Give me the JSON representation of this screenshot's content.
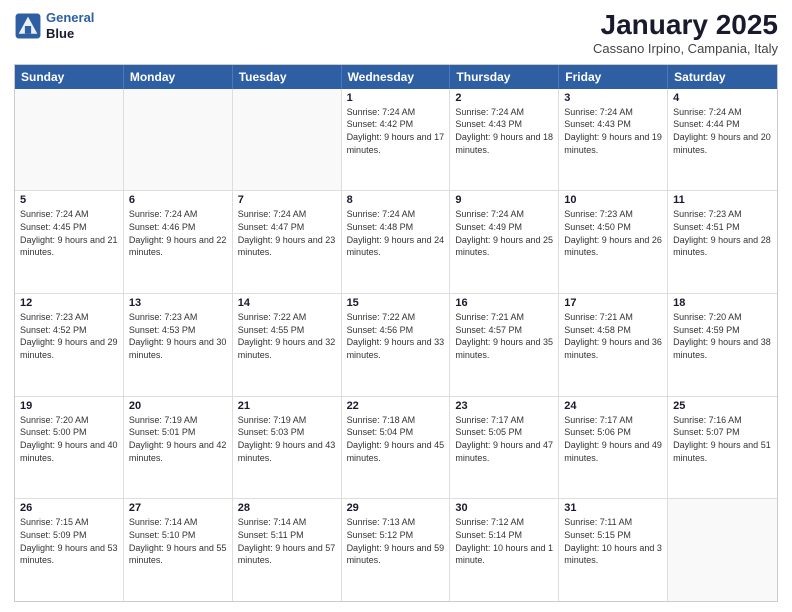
{
  "header": {
    "logo_line1": "General",
    "logo_line2": "Blue",
    "month_title": "January 2025",
    "location": "Cassano Irpino, Campania, Italy"
  },
  "day_headers": [
    "Sunday",
    "Monday",
    "Tuesday",
    "Wednesday",
    "Thursday",
    "Friday",
    "Saturday"
  ],
  "weeks": [
    [
      {
        "day": "",
        "empty": true
      },
      {
        "day": "",
        "empty": true
      },
      {
        "day": "",
        "empty": true
      },
      {
        "day": "1",
        "sunrise": "7:24 AM",
        "sunset": "4:42 PM",
        "daylight": "9 hours and 17 minutes."
      },
      {
        "day": "2",
        "sunrise": "7:24 AM",
        "sunset": "4:43 PM",
        "daylight": "9 hours and 18 minutes."
      },
      {
        "day": "3",
        "sunrise": "7:24 AM",
        "sunset": "4:43 PM",
        "daylight": "9 hours and 19 minutes."
      },
      {
        "day": "4",
        "sunrise": "7:24 AM",
        "sunset": "4:44 PM",
        "daylight": "9 hours and 20 minutes."
      }
    ],
    [
      {
        "day": "5",
        "sunrise": "7:24 AM",
        "sunset": "4:45 PM",
        "daylight": "9 hours and 21 minutes."
      },
      {
        "day": "6",
        "sunrise": "7:24 AM",
        "sunset": "4:46 PM",
        "daylight": "9 hours and 22 minutes."
      },
      {
        "day": "7",
        "sunrise": "7:24 AM",
        "sunset": "4:47 PM",
        "daylight": "9 hours and 23 minutes."
      },
      {
        "day": "8",
        "sunrise": "7:24 AM",
        "sunset": "4:48 PM",
        "daylight": "9 hours and 24 minutes."
      },
      {
        "day": "9",
        "sunrise": "7:24 AM",
        "sunset": "4:49 PM",
        "daylight": "9 hours and 25 minutes."
      },
      {
        "day": "10",
        "sunrise": "7:23 AM",
        "sunset": "4:50 PM",
        "daylight": "9 hours and 26 minutes."
      },
      {
        "day": "11",
        "sunrise": "7:23 AM",
        "sunset": "4:51 PM",
        "daylight": "9 hours and 28 minutes."
      }
    ],
    [
      {
        "day": "12",
        "sunrise": "7:23 AM",
        "sunset": "4:52 PM",
        "daylight": "9 hours and 29 minutes."
      },
      {
        "day": "13",
        "sunrise": "7:23 AM",
        "sunset": "4:53 PM",
        "daylight": "9 hours and 30 minutes."
      },
      {
        "day": "14",
        "sunrise": "7:22 AM",
        "sunset": "4:55 PM",
        "daylight": "9 hours and 32 minutes."
      },
      {
        "day": "15",
        "sunrise": "7:22 AM",
        "sunset": "4:56 PM",
        "daylight": "9 hours and 33 minutes."
      },
      {
        "day": "16",
        "sunrise": "7:21 AM",
        "sunset": "4:57 PM",
        "daylight": "9 hours and 35 minutes."
      },
      {
        "day": "17",
        "sunrise": "7:21 AM",
        "sunset": "4:58 PM",
        "daylight": "9 hours and 36 minutes."
      },
      {
        "day": "18",
        "sunrise": "7:20 AM",
        "sunset": "4:59 PM",
        "daylight": "9 hours and 38 minutes."
      }
    ],
    [
      {
        "day": "19",
        "sunrise": "7:20 AM",
        "sunset": "5:00 PM",
        "daylight": "9 hours and 40 minutes."
      },
      {
        "day": "20",
        "sunrise": "7:19 AM",
        "sunset": "5:01 PM",
        "daylight": "9 hours and 42 minutes."
      },
      {
        "day": "21",
        "sunrise": "7:19 AM",
        "sunset": "5:03 PM",
        "daylight": "9 hours and 43 minutes."
      },
      {
        "day": "22",
        "sunrise": "7:18 AM",
        "sunset": "5:04 PM",
        "daylight": "9 hours and 45 minutes."
      },
      {
        "day": "23",
        "sunrise": "7:17 AM",
        "sunset": "5:05 PM",
        "daylight": "9 hours and 47 minutes."
      },
      {
        "day": "24",
        "sunrise": "7:17 AM",
        "sunset": "5:06 PM",
        "daylight": "9 hours and 49 minutes."
      },
      {
        "day": "25",
        "sunrise": "7:16 AM",
        "sunset": "5:07 PM",
        "daylight": "9 hours and 51 minutes."
      }
    ],
    [
      {
        "day": "26",
        "sunrise": "7:15 AM",
        "sunset": "5:09 PM",
        "daylight": "9 hours and 53 minutes."
      },
      {
        "day": "27",
        "sunrise": "7:14 AM",
        "sunset": "5:10 PM",
        "daylight": "9 hours and 55 minutes."
      },
      {
        "day": "28",
        "sunrise": "7:14 AM",
        "sunset": "5:11 PM",
        "daylight": "9 hours and 57 minutes."
      },
      {
        "day": "29",
        "sunrise": "7:13 AM",
        "sunset": "5:12 PM",
        "daylight": "9 hours and 59 minutes."
      },
      {
        "day": "30",
        "sunrise": "7:12 AM",
        "sunset": "5:14 PM",
        "daylight": "10 hours and 1 minute."
      },
      {
        "day": "31",
        "sunrise": "7:11 AM",
        "sunset": "5:15 PM",
        "daylight": "10 hours and 3 minutes."
      },
      {
        "day": "",
        "empty": true
      }
    ]
  ]
}
